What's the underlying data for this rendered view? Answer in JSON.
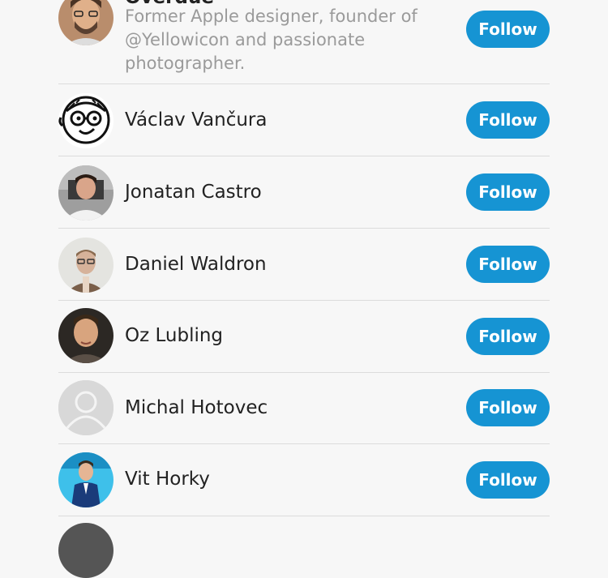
{
  "users": [
    {
      "name": "Overdue",
      "bio": "Former Apple designer, founder of @Yellowicon and passionate photographer.",
      "follow_label": "Follow"
    },
    {
      "name": "Václav Vančura",
      "follow_label": "Follow"
    },
    {
      "name": "Jonatan Castro",
      "follow_label": "Follow"
    },
    {
      "name": "Daniel Waldron",
      "follow_label": "Follow"
    },
    {
      "name": "Oz Lubling",
      "follow_label": "Follow"
    },
    {
      "name": "Michal Hotovec",
      "follow_label": "Follow"
    },
    {
      "name": "Vit Horky",
      "follow_label": "Follow"
    }
  ]
}
